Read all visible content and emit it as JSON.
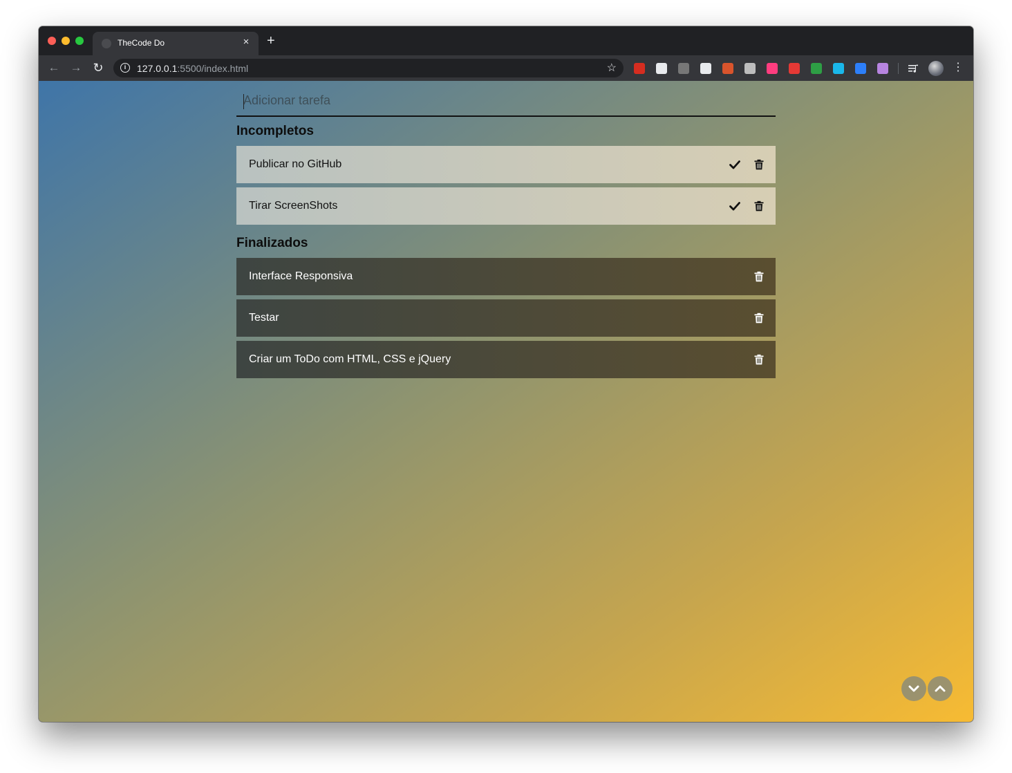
{
  "browser": {
    "tab_title": "TheCode Do",
    "tab_close": "×",
    "new_tab": "+",
    "url_host": "127.0.0.1",
    "url_rest": ":5500/index.html",
    "info_glyph": "i",
    "star_glyph": "☆",
    "back_glyph": "←",
    "forward_glyph": "→",
    "reload_glyph": "↻",
    "menu_glyph": "⋮",
    "extensions": [
      {
        "name": "adblock-icon",
        "color": "#d62d20"
      },
      {
        "name": "react-icon",
        "color": "#e8eaed"
      },
      {
        "name": "code-icon",
        "color": "#777777"
      },
      {
        "name": "bookmark-icon",
        "color": "#e8eaed"
      },
      {
        "name": "wappalyzer-icon",
        "color": "#d9542c"
      },
      {
        "name": "lighthouse-icon",
        "color": "#bdbdbd"
      },
      {
        "name": "color-picker-icon",
        "color": "#ff3d7f"
      },
      {
        "name": "screenshot-icon",
        "color": "#e53935"
      },
      {
        "name": "resize-icon",
        "color": "#2e9e45"
      },
      {
        "name": "vimeo-icon",
        "color": "#1ab7ea"
      },
      {
        "name": "vpn-icon",
        "color": "#2d7ff9"
      },
      {
        "name": "font-icon",
        "color": "#b784e0"
      }
    ]
  },
  "todo": {
    "input_placeholder": "Adicionar tarefa",
    "pending_title": "Incompletos",
    "done_title": "Finalizados",
    "pending": [
      {
        "label": "Publicar no GitHub"
      },
      {
        "label": "Tirar ScreenShots"
      }
    ],
    "done": [
      {
        "label": "Interface Responsiva"
      },
      {
        "label": "Testar"
      },
      {
        "label": "Criar um ToDo com HTML, CSS e jQuery"
      }
    ]
  },
  "colors": {
    "gradient_start": "#3f75a8",
    "gradient_end": "#f7bb33"
  }
}
